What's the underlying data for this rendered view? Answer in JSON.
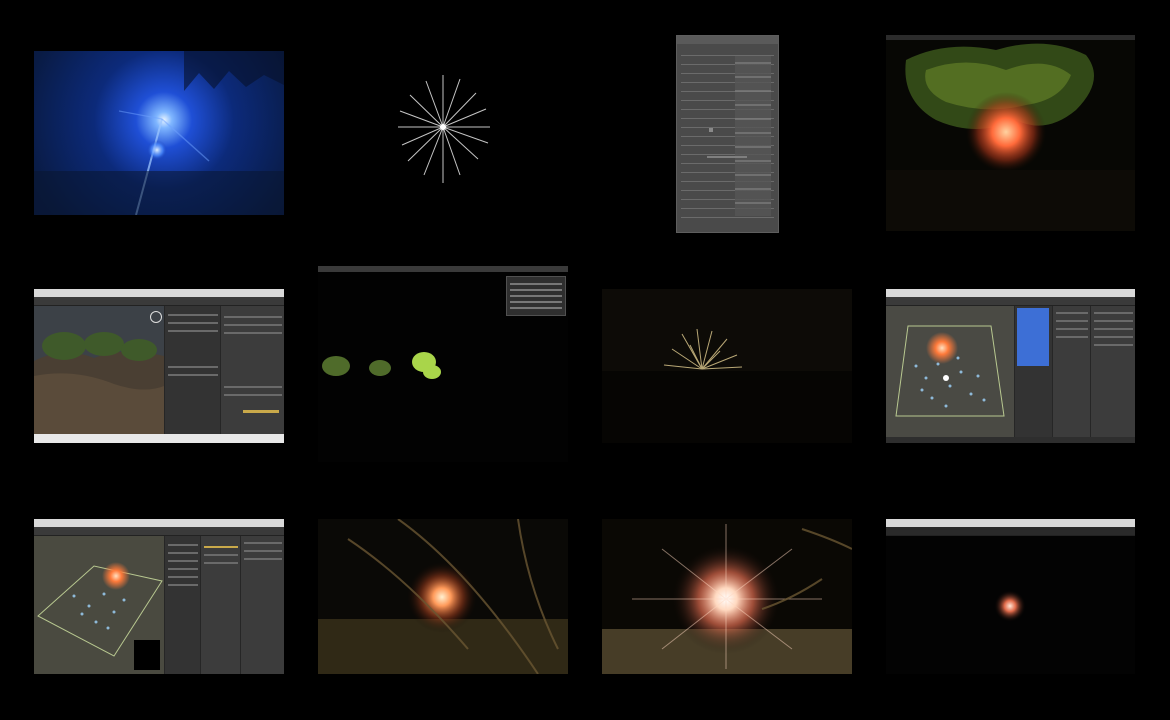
{
  "grid": {
    "columns": 4,
    "rows": 3,
    "tiles": [
      {
        "kind": "photo-blue-light"
      },
      {
        "kind": "starburst"
      },
      {
        "kind": "inspector-panel"
      },
      {
        "kind": "tree-orange-glow"
      },
      {
        "kind": "editor-terrain"
      },
      {
        "kind": "black-editor-bushes"
      },
      {
        "kind": "grass-tuft"
      },
      {
        "kind": "editor-particles"
      },
      {
        "kind": "editor-particles-2"
      },
      {
        "kind": "orange-glow-grass"
      },
      {
        "kind": "flare-bright"
      },
      {
        "kind": "editor-small-glow"
      }
    ]
  },
  "colors": {
    "background": "#000000",
    "editor_panel": "#3c3c3c",
    "editor_chrome": "#d9d9d9",
    "glow_orange": "#ff7a3a",
    "glow_blue": "#3c7bff",
    "selection_blue": "#3d6fd6",
    "foliage": "#7ab63a"
  }
}
